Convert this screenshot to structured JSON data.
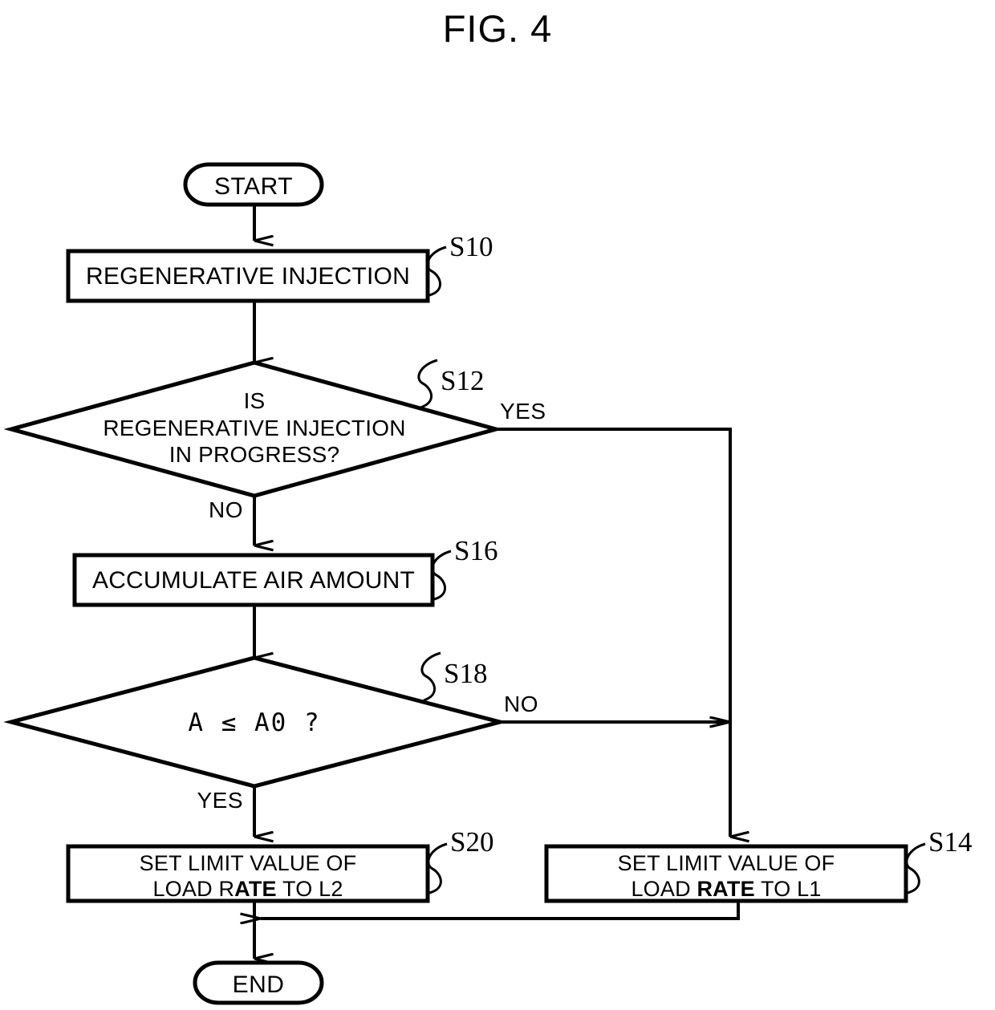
{
  "figure": {
    "title": "FIG. 4",
    "type": "flowchart",
    "ink_color": "#000000",
    "background_color": "#ffffff"
  },
  "nodes": [
    {
      "id": "start",
      "shape": "terminal",
      "text": "START",
      "step": null
    },
    {
      "id": "s10",
      "shape": "process",
      "text": "REGENERATIVE INJECTION",
      "step": "S10"
    },
    {
      "id": "s12",
      "shape": "decision",
      "text_lines": [
        "IS",
        "REGENERATIVE INJECTION",
        "IN PROGRESS?"
      ],
      "step": "S12",
      "branch_yes": "YES",
      "branch_no": "NO"
    },
    {
      "id": "s16",
      "shape": "process",
      "text": "ACCUMULATE AIR AMOUNT",
      "step": "S16"
    },
    {
      "id": "s18",
      "shape": "decision",
      "text_lines": [
        "A ≤ A0 ?"
      ],
      "step": "S18",
      "branch_yes": "YES",
      "branch_no": "NO"
    },
    {
      "id": "s20",
      "shape": "process",
      "text_lines": [
        "SET LIMIT VALUE OF",
        "LOAD RATE TO L2"
      ],
      "text_line2_prefix": "LOAD R",
      "text_line2_bold": "ATE",
      "text_line2_suffix": " TO L2",
      "step": "S20"
    },
    {
      "id": "s14",
      "shape": "process",
      "text_lines": [
        "SET LIMIT VALUE OF",
        "LOAD RATE TO L1"
      ],
      "text_line2_prefix": "LOAD ",
      "text_line2_bold": "RATE",
      "text_line2_suffix": " TO L1",
      "step": "S14"
    },
    {
      "id": "end",
      "shape": "terminal",
      "text": "END",
      "step": null
    }
  ],
  "labels": {
    "start": "START",
    "end": "END",
    "s10_text": "REGENERATIVE INJECTION",
    "s12_line1": "IS",
    "s12_line2": "REGENERATIVE INJECTION",
    "s12_line3": "IN PROGRESS?",
    "s16_text": "ACCUMULATE AIR AMOUNT",
    "s18_text": "A ≤ A0 ?",
    "s20_line1": "SET LIMIT VALUE OF",
    "s20_line2_a": "LOAD R",
    "s20_line2_b": "ATE",
    "s20_line2_c": " TO L2",
    "s14_line1": "SET LIMIT VALUE OF",
    "s14_line2_a": "LOAD ",
    "s14_line2_b": "RATE",
    "s14_line2_c": " TO L1",
    "step_s10": "S10",
    "step_s12": "S12",
    "step_s14": "S14",
    "step_s16": "S16",
    "step_s18": "S18",
    "step_s20": "S20",
    "yes_s12": "YES",
    "no_s12": "NO",
    "no_s18": "NO",
    "yes_s18": "YES"
  },
  "edges": [
    {
      "from": "start",
      "to": "s10",
      "label": ""
    },
    {
      "from": "s10",
      "to": "s12",
      "label": ""
    },
    {
      "from": "s12",
      "to": "s14",
      "label": "YES"
    },
    {
      "from": "s12",
      "to": "s16",
      "label": "NO"
    },
    {
      "from": "s16",
      "to": "s18",
      "label": ""
    },
    {
      "from": "s18",
      "to": "s14",
      "label": "NO"
    },
    {
      "from": "s18",
      "to": "s20",
      "label": "YES"
    },
    {
      "from": "s20",
      "to": "end",
      "label": ""
    },
    {
      "from": "s14",
      "to": "end",
      "label": ""
    }
  ]
}
